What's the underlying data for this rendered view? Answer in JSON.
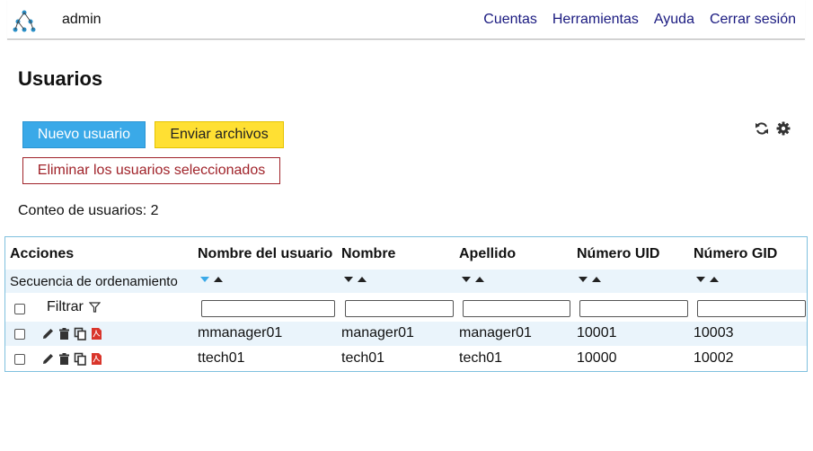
{
  "header": {
    "user": "admin",
    "nav": [
      "Cuentas",
      "Herramientas",
      "Ayuda",
      "Cerrar sesión"
    ]
  },
  "page": {
    "title": "Usuarios",
    "new_user_button": "Nuevo usuario",
    "send_files_button": "Enviar archivos",
    "delete_selected_button": "Eliminar los usuarios seleccionados",
    "count_text": "Conteo de usuarios: 2"
  },
  "table": {
    "headers": {
      "actions": "Acciones",
      "username": "Nombre del usuario",
      "first_name": "Nombre",
      "last_name": "Apellido",
      "uid": "Número UID",
      "gid": "Número GID"
    },
    "sort_label": "Secuencia de ordenamiento",
    "filter_label": "Filtrar",
    "rows": [
      {
        "username": "mmanager01",
        "first_name": "manager01",
        "last_name": "manager01",
        "uid": "10001",
        "gid": "10003"
      },
      {
        "username": "ttech01",
        "first_name": "tech01",
        "last_name": "tech01",
        "uid": "10000",
        "gid": "10002"
      }
    ]
  },
  "colors": {
    "accent_blue": "#3aa9e8",
    "yellow": "#ffe033",
    "danger": "#a0232a",
    "nav_link": "#1a1a80",
    "row_highlight": "#eaf4fb",
    "pdf_red": "#d9352b"
  },
  "icons": [
    "logo-icon",
    "refresh-icon",
    "gear-icon",
    "filter-icon",
    "edit-icon",
    "trash-icon",
    "copy-icon",
    "pdf-icon"
  ]
}
